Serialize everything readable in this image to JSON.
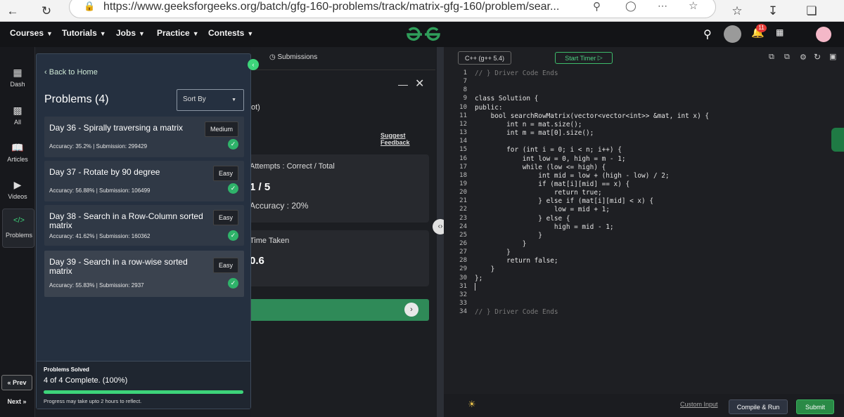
{
  "browser": {
    "url": "https://www.geeksforgeeks.org/batch/gfg-160-problems/track/matrix-gfg-160/problem/sear..."
  },
  "nav": {
    "items": [
      "Courses",
      "Tutorials",
      "Jobs",
      "Practice",
      "Contests"
    ],
    "notification_count": "11"
  },
  "rail": {
    "items": [
      "Dash",
      "All",
      "Articles",
      "Videos",
      "Problems"
    ],
    "prev": "« Prev",
    "next": "Next »"
  },
  "panel": {
    "back": "Back to Home",
    "title": "Problems (4)",
    "sort": "Sort By",
    "problems": [
      {
        "title": "Day 36 - Spirally traversing a matrix",
        "difficulty": "Medium",
        "meta": "Accuracy: 35.2% | Submission: 299429"
      },
      {
        "title": "Day 37 - Rotate by 90 degree",
        "difficulty": "Easy",
        "meta": "Accuracy: 56.88% | Submission: 106499"
      },
      {
        "title": "Day 38 - Search in a Row-Column sorted matrix",
        "difficulty": "Easy",
        "meta": "Accuracy: 41.62% | Submission: 160362"
      },
      {
        "title": "Day 39 - Search in a row-wise sorted matrix",
        "difficulty": "Easy",
        "meta": "Accuracy: 55.83% | Submission: 2937"
      }
    ],
    "solved_label": "Problems Solved",
    "solved_status": "4 of 4 Complete. (100%)",
    "solved_progress": 1.0,
    "note": "Progress may take upto 2 hours to reflect."
  },
  "middle": {
    "submissions_tab": "Submissions",
    "partial_text": "ot)",
    "feedback": "Suggest Feedback",
    "attempts_label": "Attempts : Correct / Total",
    "attempts_value": "1 / 5",
    "accuracy": "Accuracy : 20%",
    "time_label": "Time Taken",
    "time_value": "0.6"
  },
  "editor": {
    "language": "C++ (g++ 5.4)",
    "timer": "Start Timer",
    "lines": [
      {
        "n": "1",
        "t": "// } Driver Code Ends"
      },
      {
        "n": "7",
        "t": ""
      },
      {
        "n": "8",
        "t": ""
      },
      {
        "n": "9",
        "t": "class Solution {"
      },
      {
        "n": "10",
        "t": "public:"
      },
      {
        "n": "11",
        "t": "    bool searchRowMatrix(vector<vector<int>> &mat, int x) {"
      },
      {
        "n": "12",
        "t": "        int n = mat.size();"
      },
      {
        "n": "13",
        "t": "        int m = mat[0].size();"
      },
      {
        "n": "14",
        "t": ""
      },
      {
        "n": "15",
        "t": "        for (int i = 0; i < n; i++) {"
      },
      {
        "n": "16",
        "t": "            int low = 0, high = m - 1;"
      },
      {
        "n": "17",
        "t": "            while (low <= high) {"
      },
      {
        "n": "18",
        "t": "                int mid = low + (high - low) / 2;"
      },
      {
        "n": "19",
        "t": "                if (mat[i][mid] == x) {"
      },
      {
        "n": "20",
        "t": "                    return true;"
      },
      {
        "n": "21",
        "t": "                } else if (mat[i][mid] < x) {"
      },
      {
        "n": "22",
        "t": "                    low = mid + 1;"
      },
      {
        "n": "23",
        "t": "                } else {"
      },
      {
        "n": "24",
        "t": "                    high = mid - 1;"
      },
      {
        "n": "25",
        "t": "                }"
      },
      {
        "n": "26",
        "t": "            }"
      },
      {
        "n": "27",
        "t": "        }"
      },
      {
        "n": "28",
        "t": "        return false;"
      },
      {
        "n": "29",
        "t": "    }"
      },
      {
        "n": "30",
        "t": "};"
      },
      {
        "n": "31",
        "t": ""
      },
      {
        "n": "32",
        "t": ""
      },
      {
        "n": "33",
        "t": ""
      },
      {
        "n": "34",
        "t": "// } Driver Code Ends"
      }
    ],
    "custom_input": "Custom Input",
    "compile_run": "Compile & Run",
    "submit": "Submit"
  }
}
